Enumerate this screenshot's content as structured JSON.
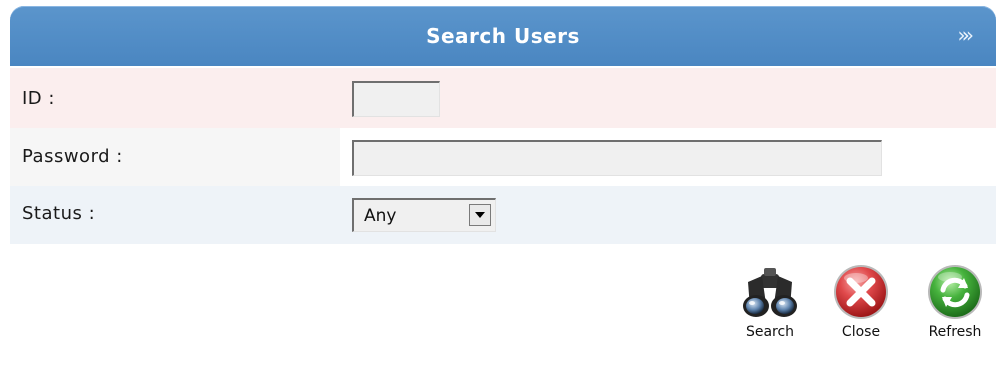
{
  "header": {
    "title": "Search Users",
    "expand_glyph": "»»"
  },
  "fields": {
    "id": {
      "label": "ID :",
      "value": ""
    },
    "password": {
      "label": "Password :",
      "value": ""
    },
    "status": {
      "label": "Status :",
      "selected": "Any"
    }
  },
  "actions": {
    "search": {
      "label": "Search",
      "icon": "binoculars-icon"
    },
    "close": {
      "label": "Close",
      "icon": "close-icon"
    },
    "refresh": {
      "label": "Refresh",
      "icon": "refresh-icon"
    }
  },
  "colors": {
    "header": "#4f8bc4",
    "row_id_bg": "#fbeeee",
    "row_status_bg": "#eef3f8",
    "close_red": "#d9393b",
    "refresh_green": "#3aa536"
  }
}
